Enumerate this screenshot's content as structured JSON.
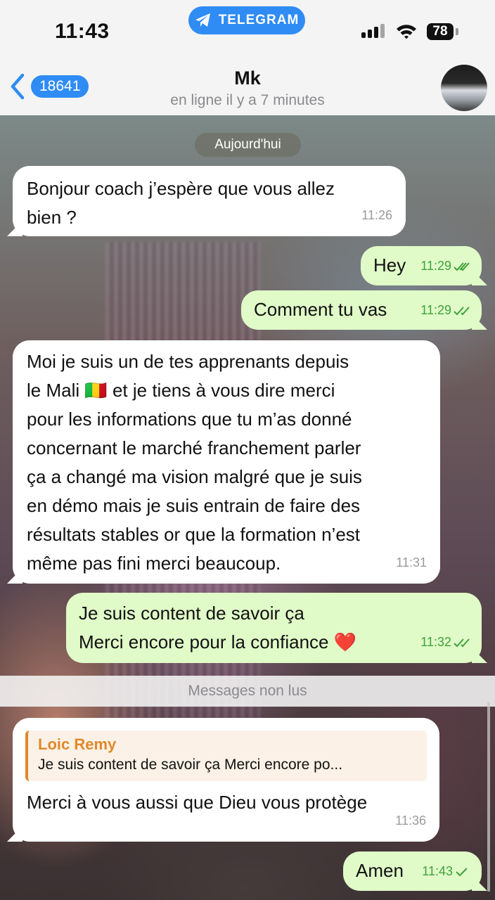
{
  "status_bar": {
    "time": "11:43",
    "app_pill": "TELEGRAM",
    "battery": "78"
  },
  "header": {
    "back_count": "18641",
    "contact_name": "Mk",
    "status": "en ligne il y a 7 minutes"
  },
  "chat": {
    "date_label": "Aujourd'hui",
    "unread_label": "Messages non lus",
    "messages": [
      {
        "direction": "in",
        "text": "Bonjour coach j’espère que vous allez\nbien ?",
        "time": "11:26"
      },
      {
        "direction": "out",
        "text": "Hey",
        "time": "11:29",
        "status": "read"
      },
      {
        "direction": "out",
        "text": "Comment tu vas",
        "time": "11:29",
        "status": "read"
      },
      {
        "direction": "in",
        "text": "Moi je suis un de tes apprenants depuis\nle Mali 🇲🇱 et je tiens à vous dire merci\npour les informations que tu m’as donné\nconcernant le marché franchement parler\nça a changé ma vision malgré que je suis\nen démo mais je suis entrain de faire des\nrésultats stables or que la formation n’est\nmême pas fini merci beaucoup.",
        "time": "11:31"
      },
      {
        "direction": "out",
        "text": "Je suis content de savoir ça\nMerci encore pour la confiance ❤️",
        "time": "11:32",
        "status": "read"
      },
      {
        "direction": "in",
        "text": "Merci à vous aussi que Dieu vous protège",
        "time": "11:36",
        "reply_to": {
          "name": "Loic Remy",
          "text": "Je suis content de savoir ça Merci encore po..."
        }
      },
      {
        "direction": "out",
        "text": "Amen",
        "time": "11:43",
        "status": "sent"
      }
    ]
  },
  "colors": {
    "accent": "#2f8cf4",
    "outgoing_bubble": "#e0fac8",
    "incoming_bubble": "#ffffff",
    "check_green": "#3ea33c",
    "reply_accent": "#e0892b"
  }
}
